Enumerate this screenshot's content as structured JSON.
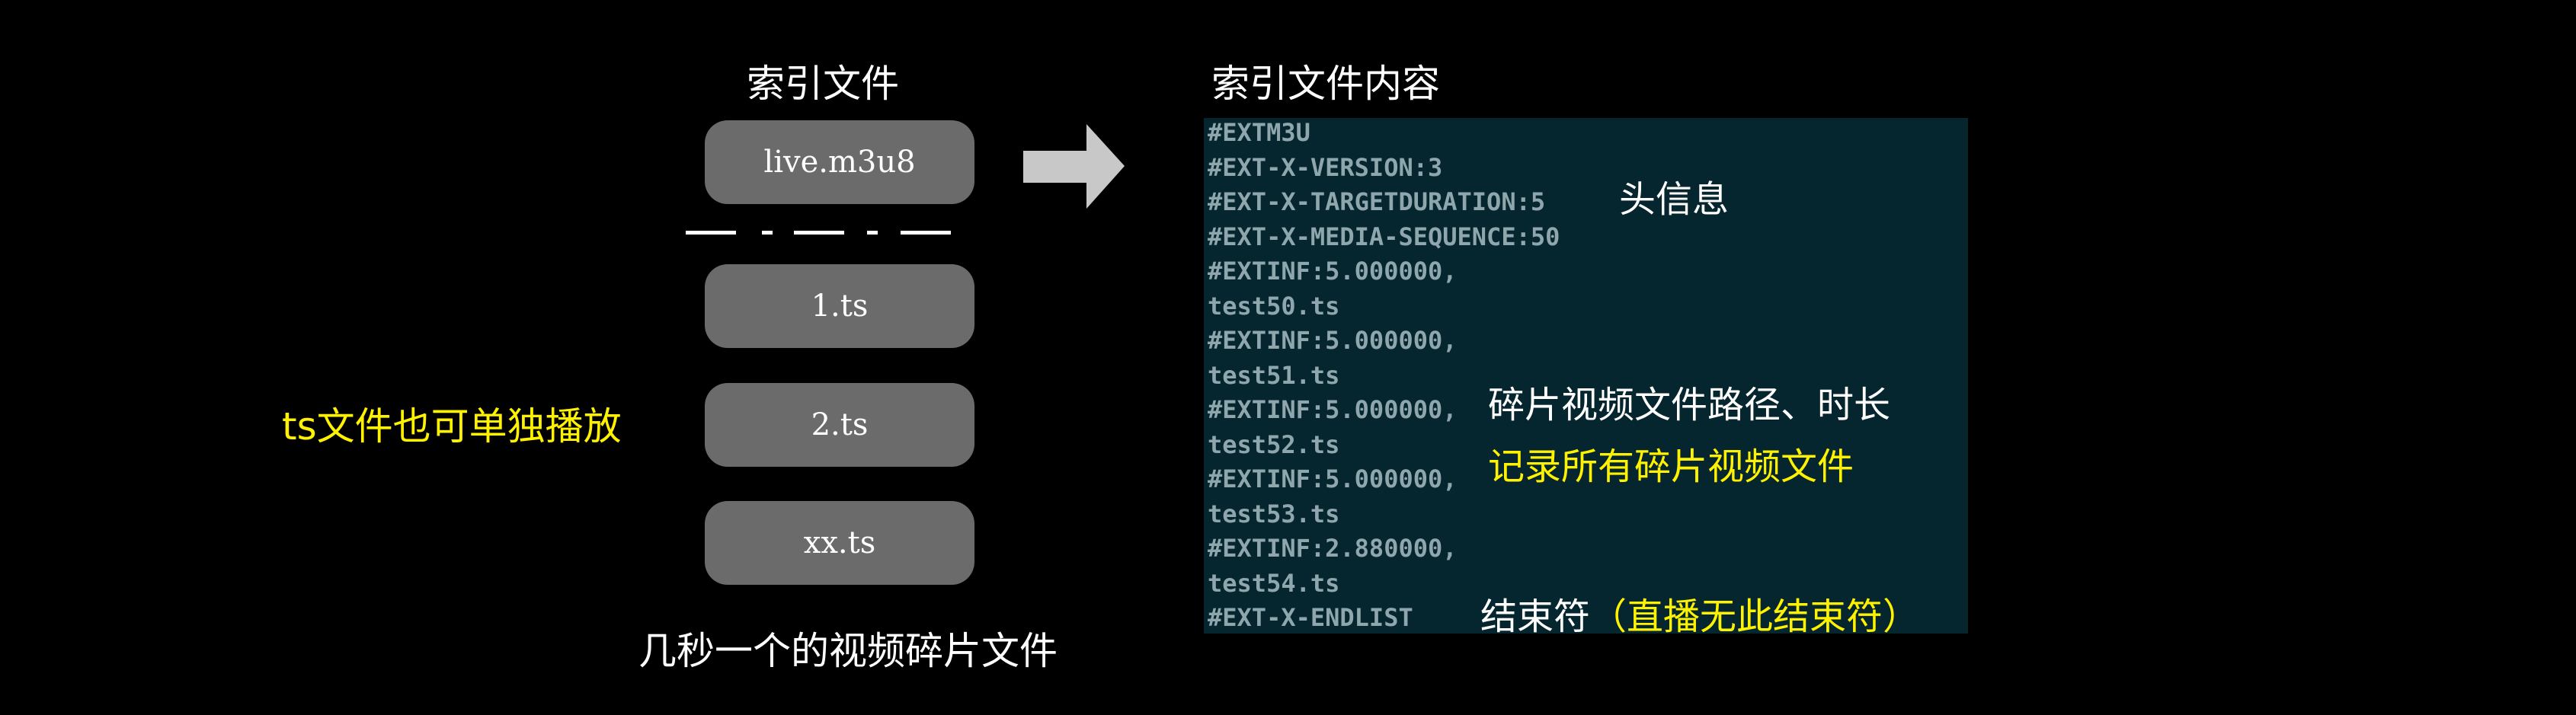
{
  "colors": {
    "background": "#000000",
    "pill": "#6b6b6b",
    "code_bg": "#05262f",
    "code_text": "#8fa6ad",
    "highlight": "#fff200",
    "text": "#ffffff"
  },
  "left": {
    "heading": "索引文件",
    "index_file": "live.m3u8",
    "segments": [
      "1.ts",
      "2.ts",
      "xx.ts"
    ],
    "caption": "几秒一个的视频碎片文件",
    "note": "ts文件也可单独播放"
  },
  "right": {
    "heading": "索引文件内容",
    "code_lines": [
      "#EXTM3U",
      "#EXT-X-VERSION:3",
      "#EXT-X-TARGETDURATION:5",
      "#EXT-X-MEDIA-SEQUENCE:50",
      "#EXTINF:5.000000,",
      "test50.ts",
      "#EXTINF:5.000000,",
      "test51.ts",
      "#EXTINF:5.000000,",
      "test52.ts",
      "#EXTINF:5.000000,",
      "test53.ts",
      "#EXTINF:2.880000,",
      "test54.ts",
      "#EXT-X-ENDLIST"
    ],
    "annotations": {
      "header_info": "头信息",
      "segment_info": "碎片视频文件路径、时长",
      "segment_record": "记录所有碎片视频文件",
      "end_marker": "结束符",
      "end_note": "（直播无此结束符）"
    }
  },
  "arrow_icon": "right-arrow-icon"
}
